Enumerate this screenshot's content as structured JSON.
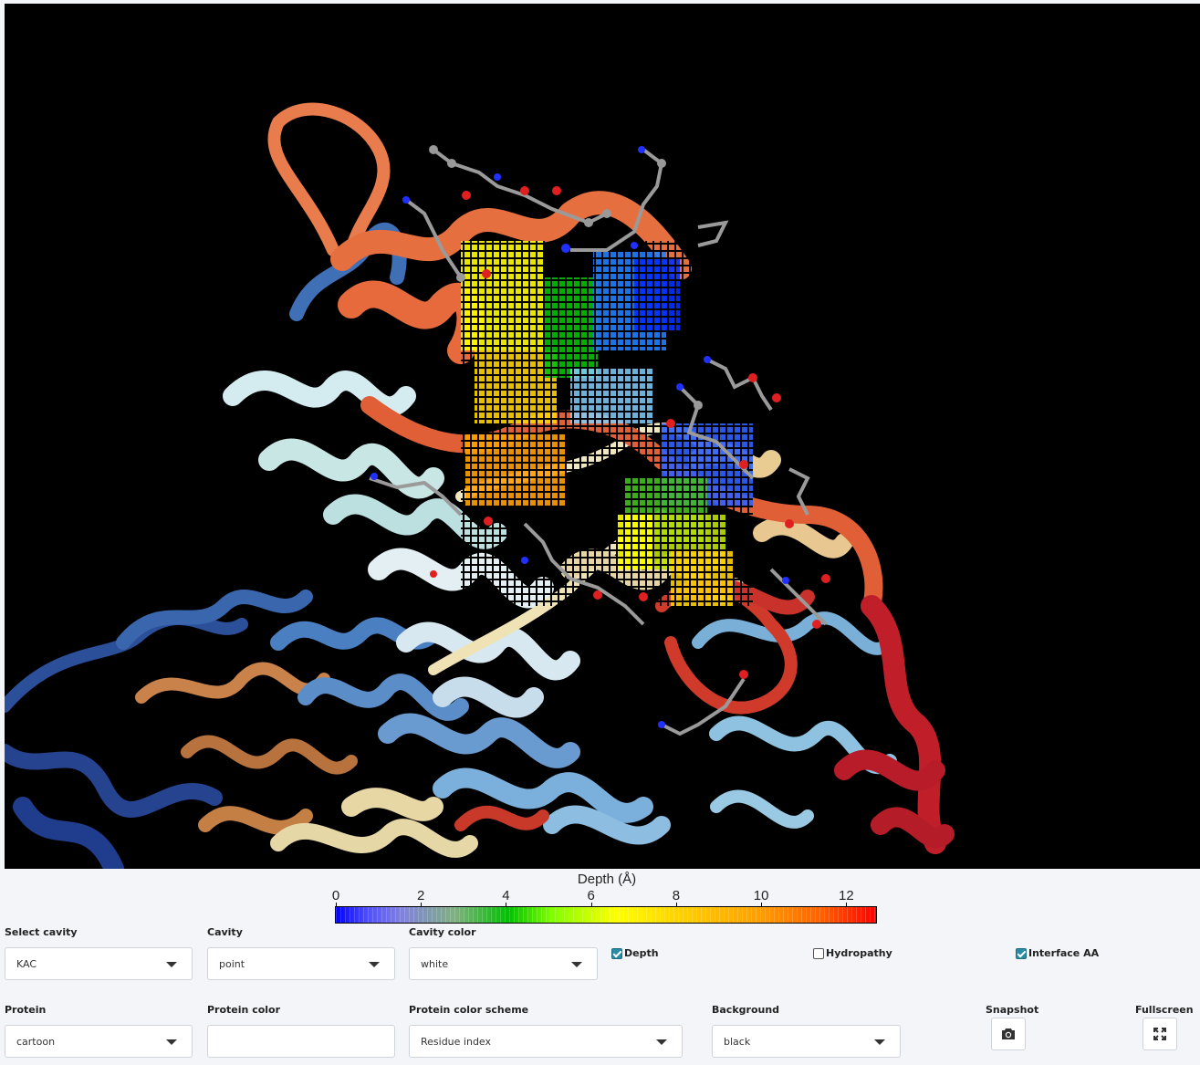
{
  "legend": {
    "title": "Depth (Å)",
    "ticks": [
      "0",
      "2",
      "4",
      "6",
      "8",
      "10",
      "12"
    ],
    "range": [
      0,
      12.7
    ]
  },
  "controls": {
    "select_cavity": {
      "label": "Select cavity",
      "value": "KAC"
    },
    "cavity": {
      "label": "Cavity",
      "value": "point"
    },
    "cavity_color": {
      "label": "Cavity color",
      "value": "white"
    },
    "depth": {
      "label": "Depth",
      "checked": true
    },
    "hydropathy": {
      "label": "Hydropathy",
      "checked": false
    },
    "interface_aa": {
      "label": "Interface AA",
      "checked": true
    },
    "protein": {
      "label": "Protein",
      "value": "cartoon"
    },
    "protein_color": {
      "label": "Protein color",
      "value": ""
    },
    "protein_color_scheme": {
      "label": "Protein color scheme",
      "value": "Residue index"
    },
    "background": {
      "label": "Background",
      "value": "black"
    },
    "snapshot": {
      "label": "Snapshot",
      "icon": "camera-icon"
    },
    "fullscreen": {
      "label": "Fullscreen",
      "icon": "fullscreen-icon"
    }
  },
  "colors": {
    "viewer_background": "#000000",
    "accent": "#2a8ba5"
  }
}
